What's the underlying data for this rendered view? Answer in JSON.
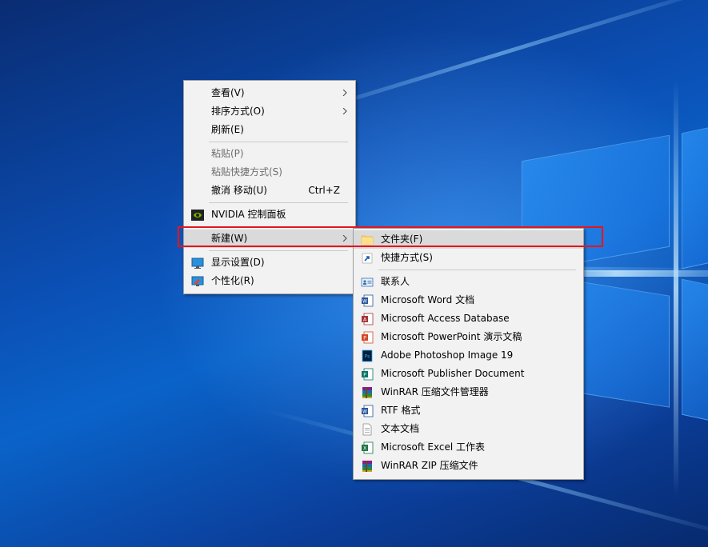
{
  "context_menu": {
    "items": [
      {
        "label": "查看(V)",
        "submenu": true
      },
      {
        "label": "排序方式(O)",
        "submenu": true
      },
      {
        "label": "刷新(E)"
      },
      {
        "label": "粘贴(P)",
        "disabled": true
      },
      {
        "label": "粘贴快捷方式(S)",
        "disabled": true
      },
      {
        "label": "撤消 移动(U)",
        "shortcut": "Ctrl+Z"
      },
      {
        "label": "NVIDIA 控制面板",
        "icon": "nvidia-icon"
      },
      {
        "label": "新建(W)",
        "submenu": true,
        "active": true
      },
      {
        "label": "显示设置(D)",
        "icon": "display-icon"
      },
      {
        "label": "个性化(R)",
        "icon": "personalize-icon"
      }
    ]
  },
  "new_submenu": {
    "items": [
      {
        "label": "文件夹(F)",
        "icon": "folder-icon",
        "active": true
      },
      {
        "label": "快捷方式(S)",
        "icon": "shortcut-icon"
      },
      {
        "label": "联系人",
        "icon": "contact-icon"
      },
      {
        "label": "Microsoft Word 文档",
        "icon": "word-icon"
      },
      {
        "label": "Microsoft Access Database",
        "icon": "access-icon"
      },
      {
        "label": "Microsoft PowerPoint 演示文稿",
        "icon": "powerpoint-icon"
      },
      {
        "label": "Adobe Photoshop Image 19",
        "icon": "photoshop-icon"
      },
      {
        "label": "Microsoft Publisher Document",
        "icon": "publisher-icon"
      },
      {
        "label": "WinRAR 压缩文件管理器",
        "icon": "winrar-icon"
      },
      {
        "label": "RTF 格式",
        "icon": "rtf-icon"
      },
      {
        "label": "文本文档",
        "icon": "text-document-icon"
      },
      {
        "label": "Microsoft Excel 工作表",
        "icon": "excel-icon"
      },
      {
        "label": "WinRAR ZIP 压缩文件",
        "icon": "winrar-zip-icon"
      }
    ]
  },
  "colors": {
    "menu_background": "#f2f2f2",
    "active_item": "#dadada",
    "disabled_text": "#6d6d6d",
    "highlight_outline": "#e8141c",
    "desktop_blue": "#0b4fb4"
  }
}
